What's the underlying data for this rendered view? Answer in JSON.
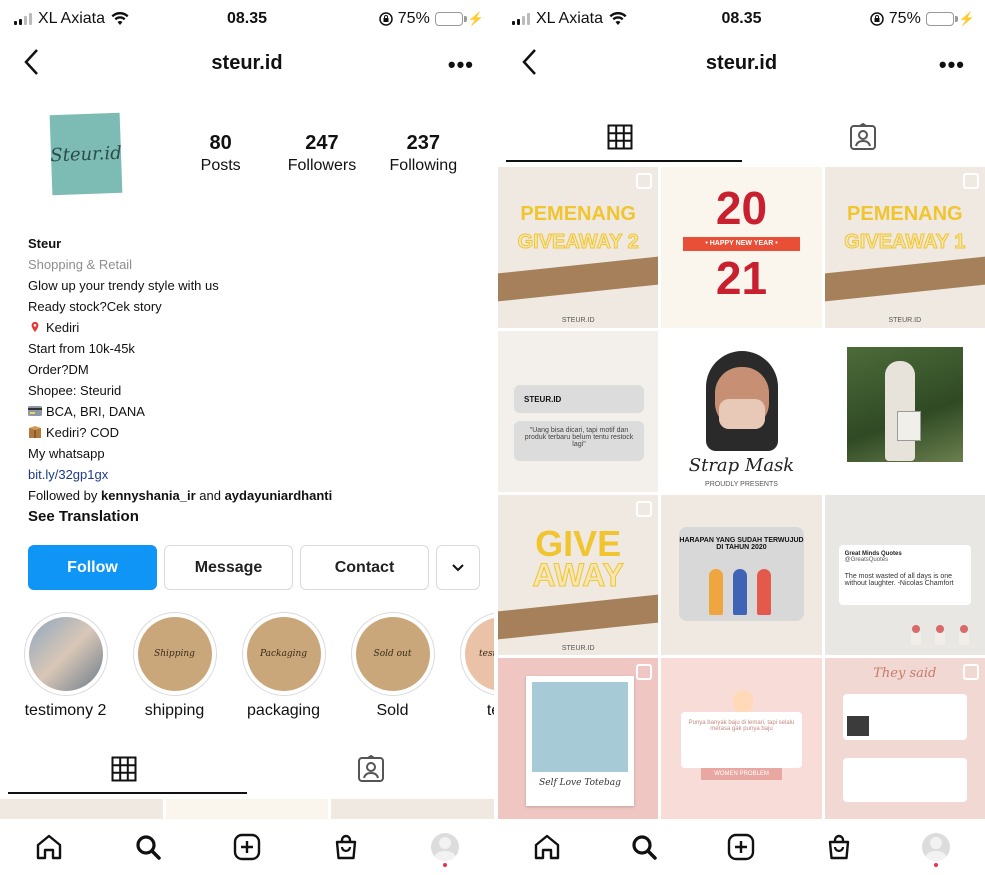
{
  "status": {
    "carrier": "XL Axiata",
    "time": "08.35",
    "battery": "75%",
    "battery_level": 0.75
  },
  "header": {
    "title": "steur.id",
    "more": "•••"
  },
  "profile": {
    "stats": [
      {
        "num": "80",
        "label": "Posts"
      },
      {
        "num": "247",
        "label": "Followers"
      },
      {
        "num": "237",
        "label": "Following"
      }
    ],
    "name": "Steur",
    "category": "Shopping & Retail",
    "bio_lines": [
      "Glow up your trendy style with us",
      "Ready stock?Cek story",
      "Kediri",
      "Start from 10k-45k",
      "Order?DM",
      "Shopee: Steurid",
      "BCA, BRI, DANA",
      "Kediri? COD",
      "My whatsapp"
    ],
    "link": "bit.ly/32gp1gx",
    "followed_prefix": "Followed by ",
    "followed_user1": "kennyshania_ir",
    "followed_and": " and ",
    "followed_user2": "aydayuniardhanti",
    "see_translation": "See Translation",
    "logo_text": "Steur.id"
  },
  "buttons": {
    "follow": "Follow",
    "message": "Message",
    "contact": "Contact",
    "dropdown": "⌄"
  },
  "highlights": [
    {
      "label": "testimony 2",
      "cover": ""
    },
    {
      "label": "shipping",
      "cover": "Shipping"
    },
    {
      "label": "packaging",
      "cover": "Packaging"
    },
    {
      "label": "Sold",
      "cover": "Sold out"
    },
    {
      "label": "testi",
      "cover": "testimony"
    }
  ],
  "posts": {
    "giveaway2": {
      "l1": "PEMENANG",
      "l2": "GIVEAWAY 2",
      "foot": "STEUR.ID"
    },
    "newyear": {
      "n1": "20",
      "band": "• HAPPY NEW YEAR •",
      "n2": "21"
    },
    "giveaway1": {
      "l1": "PEMENANG",
      "l2": "GIVEAWAY 1",
      "foot": "STEUR.ID"
    },
    "quote": {
      "brand": "STEUR.ID",
      "text": "\"Uang bisa dicari, tapi motif dan produk terbaru belum tentu restock lagi\""
    },
    "strapmask": {
      "title": "Strap Mask",
      "sub": "PROUDLY PRESENTS"
    },
    "giveaway": {
      "l1": "GIVE",
      "l2": "AWAY",
      "foot": "STEUR.ID"
    },
    "harapan": {
      "text": "HARAPAN YANG SUDAH TERWUJUD DI TAHUN 2020"
    },
    "tweet": {
      "name": "Great Minds Quotes",
      "handle": "@GreatsQuotes",
      "text": "The most wasted of all days is one without laughter. -Nicolas Chamfort"
    },
    "selflove": {
      "caption": "Self Love Totebag"
    },
    "women": {
      "text": "Punya banyak baju di lemari, tapi selalu merasa gak punya baju",
      "bar": "WOMEN PROBLEM"
    },
    "theysaid": {
      "title": "They said"
    }
  },
  "colors": {
    "follow": "#0f95f6",
    "accent_yellow": "#f0c530",
    "red": "#c8202e",
    "notif": "#ed2f4f"
  },
  "icons": {
    "nav": [
      "home-icon",
      "search-icon",
      "add-post-icon",
      "shop-icon",
      "profile-avatar"
    ],
    "tabs": [
      "grid-icon",
      "tagged-icon"
    ]
  }
}
